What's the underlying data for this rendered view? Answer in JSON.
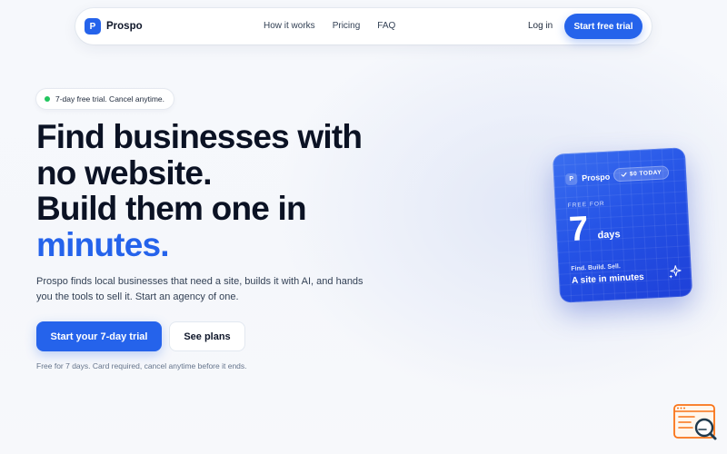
{
  "nav": {
    "brand": "Prospo",
    "brand_initial": "P",
    "links": [
      "How it works",
      "Pricing",
      "FAQ"
    ],
    "login": "Log in",
    "cta": "Start free trial"
  },
  "hero": {
    "pill": "7-day free trial. Cancel anytime.",
    "headline": [
      "Find businesses with",
      "no website.",
      "Build them one in"
    ],
    "headline_accent": "minutes.",
    "subtext": "Prospo finds local businesses that need a site, builds it with AI, and hands you the tools to sell it. Start an agency of one.",
    "primary_button": "Start your 7-day trial",
    "secondary_button": "See plans",
    "fineprint": "Free for 7 days. Card required, cancel anytime before it ends."
  },
  "card": {
    "brand": "Prospo",
    "brand_initial": "P",
    "badge": "$0 TODAY",
    "badge_icon": "check-icon",
    "free_for": "FREE FOR",
    "number": "7",
    "unit": "days",
    "tagline": "Find. Build. Sell.",
    "headline": "A site in minutes",
    "icon": "sparkle-icon"
  },
  "colors": {
    "accent": "#2563eb",
    "pill_dot": "#22c55e",
    "widget": "#f97316"
  },
  "widget": {
    "icon": "search-chat-icon"
  }
}
